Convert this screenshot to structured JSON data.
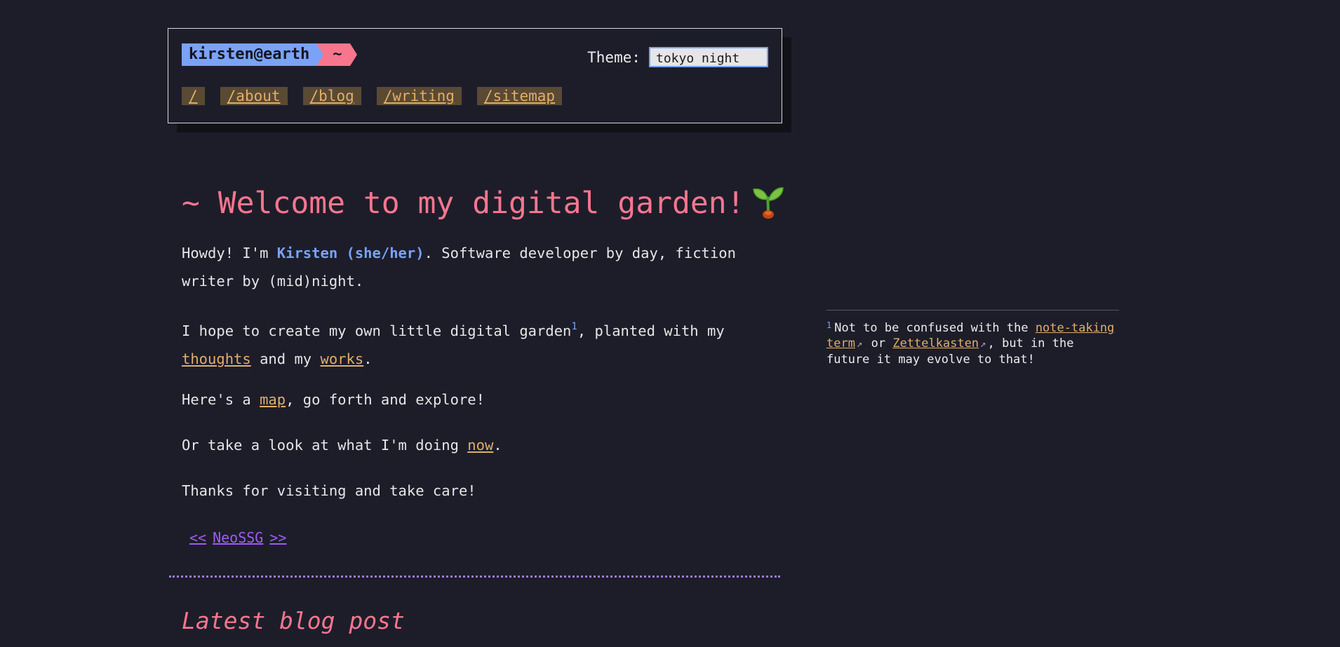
{
  "header": {
    "prompt_user": "kirsten@earth",
    "prompt_dir": "~",
    "theme_label": "Theme:",
    "theme_value": "tokyo night",
    "nav": [
      "/",
      "/about",
      "/blog",
      "/writing",
      "/sitemap"
    ]
  },
  "main": {
    "title": "~ Welcome to my digital garden!",
    "title_emoji": "sprout-icon",
    "p1": {
      "before": "Howdy! I'm ",
      "name": "Kirsten (she/her)",
      "after": ". Software developer by day, fiction writer by (mid)night."
    },
    "p2": {
      "before": "I hope to create my own little digital garden",
      "fnref": "1",
      "middle": ", planted with my ",
      "link1": "thoughts",
      "between": " and my ",
      "link2": "works",
      "end": "."
    },
    "p3": {
      "before": "Here's a ",
      "link": "map",
      "after": ", go forth and explore!"
    },
    "p4": {
      "before": "Or take a look at what I'm doing ",
      "link": "now",
      "after": "."
    },
    "p5": "Thanks for visiting and take care!",
    "webring": {
      "prev": "<<",
      "name": "NeoSSG",
      "next": ">>"
    },
    "latest_heading": "Latest blog post"
  },
  "footnote": {
    "number": "1",
    "text_before": "Not to be confused with the ",
    "link1": "note-taking term",
    "between": " or ",
    "link2": "Zettelkasten",
    "text_after": ", but in the future it may evolve to that!",
    "external_icon": "↗"
  },
  "colors": {
    "background": "#1d1d2a",
    "accent_blue": "#7aa2f7",
    "accent_pink": "#f7768e",
    "link_orange": "#e0af68",
    "webring_purple": "#a15bf2",
    "divider_purple": "#9d7cd8"
  }
}
